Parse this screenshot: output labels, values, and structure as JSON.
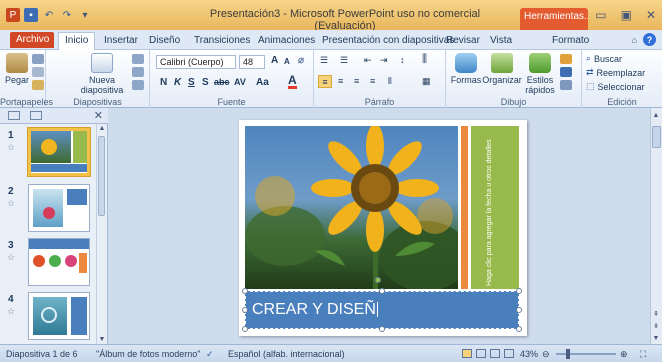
{
  "window": {
    "title": "Presentación3 - Microsoft PowerPoint uso no comercial (Evaluación)",
    "context_tab": "Herramientas...",
    "buttons": {
      "minimize": "▭",
      "restore": "▣",
      "close": "✕"
    }
  },
  "quick_access": [
    "powerpoint-logo",
    "save",
    "undo",
    "redo",
    "customize"
  ],
  "tabs": [
    {
      "label": "Archivo"
    },
    {
      "label": "Inicio"
    },
    {
      "label": "Insertar"
    },
    {
      "label": "Diseño"
    },
    {
      "label": "Transiciones"
    },
    {
      "label": "Animaciones"
    },
    {
      "label": "Presentación con diapositivas"
    },
    {
      "label": "Revisar"
    },
    {
      "label": "Vista"
    },
    {
      "label": "Formato"
    }
  ],
  "ribbon": {
    "portapapeles": {
      "label": "Portapapeles",
      "paste": "Pegar"
    },
    "diapositivas": {
      "label": "Diapositivas",
      "new_slide": "Nueva diapositiva"
    },
    "fuente": {
      "label": "Fuente",
      "font_name": "Calibri (Cuerpo)",
      "font_size": "48",
      "bold": "N",
      "italic": "K",
      "underline": "S",
      "shadow": "S",
      "strike": "abc",
      "spacing": "AV",
      "case": "Aa",
      "color": "A"
    },
    "parrafo": {
      "label": "Párrafo"
    },
    "dibujo": {
      "label": "Dibujo",
      "shapes": "Formas",
      "arrange": "Organizar",
      "styles": "Estilos rápidos"
    },
    "edicion": {
      "label": "Edición",
      "find": "Buscar",
      "replace": "Reemplazar",
      "select": "Seleccionar"
    }
  },
  "slides_panel": {
    "slides": [
      {
        "number": "1",
        "selected": true
      },
      {
        "number": "2",
        "selected": false
      },
      {
        "number": "3",
        "selected": false
      },
      {
        "number": "4",
        "selected": false
      }
    ]
  },
  "slide": {
    "title_text": "CREAR Y DISEÑ",
    "vertical_text": "Haga clic para agregar la fecha u otros detalles"
  },
  "status": {
    "slide_pos": "Diapositiva 1 de 6",
    "theme": "\"Álbum de fotos moderno\"",
    "language": "Español (alfab. internacional)",
    "zoom": "43%"
  },
  "colors": {
    "title_bar": "#e8b65c",
    "archivo_tab": "#d24726",
    "slide_title_fill": "#4a7fbd",
    "accent_orange": "#eb8a3f",
    "accent_green": "#98b94b"
  }
}
